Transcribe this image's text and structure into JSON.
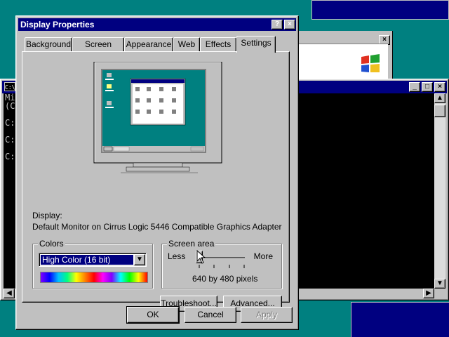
{
  "dialog": {
    "title": "Display Properties",
    "help_button": "?",
    "close_button": "×",
    "tabs": [
      {
        "label": "Background"
      },
      {
        "label": "Screen Saver"
      },
      {
        "label": "Appearance"
      },
      {
        "label": "Web"
      },
      {
        "label": "Effects"
      },
      {
        "label": "Settings",
        "active": true
      }
    ],
    "display_label": "Display:",
    "display_value": "Default Monitor on Cirrus Logic 5446 Compatible Graphics Adapter",
    "colors": {
      "group_label": "Colors",
      "selected": "High Color (16 bit)"
    },
    "screen_area": {
      "group_label": "Screen area",
      "less": "Less",
      "more": "More",
      "value_text": "640 by 480 pixels",
      "slider_position": 0.0
    },
    "troubleshoot_button": "Troubleshoot...",
    "advanced_button": "Advanced...",
    "ok_button": "OK",
    "cancel_button": "Cancel",
    "apply_button": "Apply"
  },
  "console": {
    "lines": [
      "Mi",
      "(C",
      "",
      "C:",
      "",
      "C:",
      "",
      "C:"
    ],
    "title_icon": "C:\\"
  },
  "colors": {
    "desktop": "#008080",
    "titlebar": "#000080",
    "face": "#c0c0c0",
    "selection": "#000080"
  }
}
